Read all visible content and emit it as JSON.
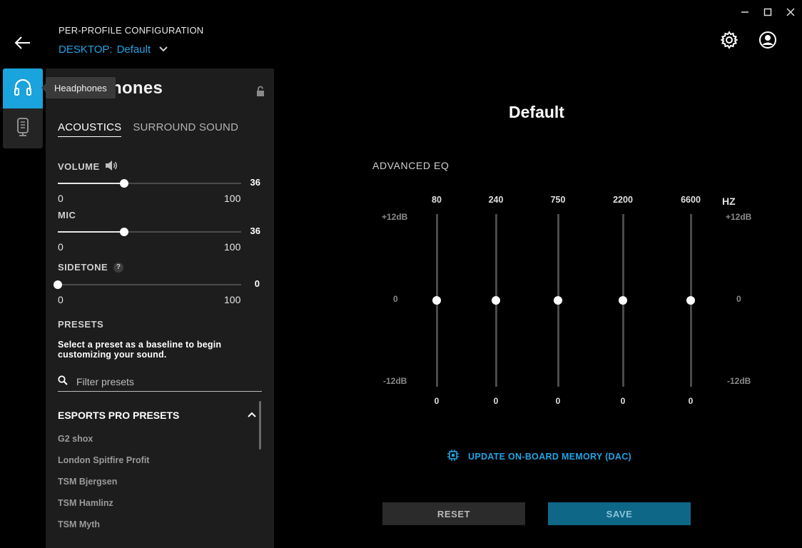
{
  "window": {
    "minimize_label": "–",
    "maximize_label": "□",
    "close_label": "✕"
  },
  "header": {
    "title": "PER-PROFILE CONFIGURATION",
    "profile_prefix": "DESKTOP:",
    "profile_name": "Default"
  },
  "rail": {
    "tooltip": "Headphones"
  },
  "panel": {
    "title_visible": "hones",
    "tabs": [
      {
        "label": "ACOUSTICS",
        "active": true
      },
      {
        "label": "SURROUND SOUND",
        "active": false
      }
    ],
    "volume": {
      "label": "VOLUME",
      "value": 36,
      "min": 0,
      "max": 100,
      "value_text": "36",
      "min_text": "0",
      "max_text": "100"
    },
    "mic": {
      "label": "MIC",
      "value": 36,
      "min": 0,
      "max": 100,
      "value_text": "36",
      "min_text": "0",
      "max_text": "100"
    },
    "sidetone": {
      "label": "SIDETONE",
      "help": "?",
      "value": 0,
      "min": 0,
      "max": 100,
      "value_text": "0",
      "min_text": "0",
      "max_text": "100"
    },
    "presets": {
      "label": "PRESETS",
      "description": "Select a preset as a baseline to begin customizing your sound.",
      "search_placeholder": "Filter presets",
      "group_label": "ESPORTS PRO PRESETS",
      "items": [
        "G2 shox",
        "London Spitfire Profit",
        "TSM Bjergsen",
        "TSM Hamlinz",
        "TSM Myth"
      ]
    }
  },
  "main": {
    "title": "Default",
    "eq_title": "ADVANCED EQ",
    "db_top": "+12dB",
    "db_mid": "0",
    "db_bottom": "-12dB",
    "hz_label": "HZ",
    "bands": [
      {
        "freq": "80",
        "gain": 0,
        "gain_text": "0"
      },
      {
        "freq": "240",
        "gain": 0,
        "gain_text": "0"
      },
      {
        "freq": "750",
        "gain": 0,
        "gain_text": "0"
      },
      {
        "freq": "2200",
        "gain": 0,
        "gain_text": "0"
      },
      {
        "freq": "6600",
        "gain": 0,
        "gain_text": "0"
      }
    ],
    "eq_range": [
      -12,
      12
    ],
    "update_label": "UPDATE ON-BOARD MEMORY (DAC)",
    "reset_label": "RESET",
    "save_label": "SAVE"
  },
  "colors": {
    "accent": "#1fa3e6",
    "rail_active": "#1aa3dc",
    "save_bg": "#0e6787",
    "panel_bg": "#1d1d1d"
  },
  "icons": [
    "back-arrow-icon",
    "chevron-down-icon",
    "gear-icon",
    "account-icon",
    "headphones-icon",
    "microphone-device-icon",
    "lock-icon",
    "speaker-icon",
    "search-icon",
    "chevron-up-icon",
    "chip-icon"
  ]
}
